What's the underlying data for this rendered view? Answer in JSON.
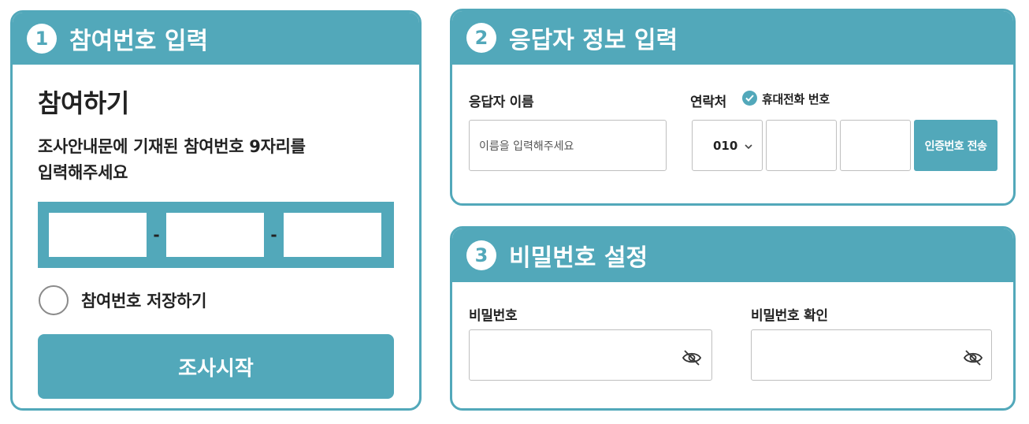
{
  "section1": {
    "number": "1",
    "title": "참여번호 입력",
    "heading": "참여하기",
    "description_line1": "조사안내문에 기재된 참여번호 9자리를",
    "description_line2": "입력해주세요",
    "code_separator": "-",
    "save_label": "참여번호 저장하기",
    "start_button": "조사시작"
  },
  "section2": {
    "number": "2",
    "title": "응답자 정보 입력",
    "name_label": "응답자 이름",
    "name_placeholder": "이름을 입력해주세요",
    "contact_label": "연락처",
    "contact_type": "휴대전화 번호",
    "phone_prefix": "010",
    "auth_button": "인증번호 전송"
  },
  "section3": {
    "number": "3",
    "title": "비밀번호 설정",
    "password_label": "비밀번호",
    "password_confirm_label": "비밀번호 확인"
  },
  "colors": {
    "accent": "#52a8ba",
    "input_border": "#bfbfbf"
  }
}
